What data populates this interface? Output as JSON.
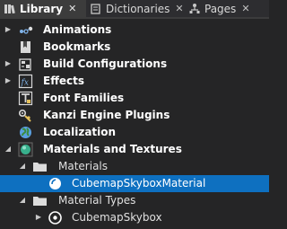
{
  "tabs": [
    {
      "label": "Library",
      "active": true,
      "icon": "library-icon"
    },
    {
      "label": "Dictionaries",
      "active": false,
      "icon": "book-icon"
    },
    {
      "label": "Pages",
      "active": false,
      "icon": "pages-icon"
    }
  ],
  "tab_close_glyph": "✕",
  "tree": {
    "items": [
      {
        "label": "Animations",
        "icon": "animation-icon",
        "expander": "collapsed"
      },
      {
        "label": "Bookmarks",
        "icon": "bookmark-icon",
        "expander": "none"
      },
      {
        "label": "Build Configurations",
        "icon": "build-icon",
        "expander": "collapsed"
      },
      {
        "label": "Effects",
        "icon": "fx-icon",
        "expander": "collapsed"
      },
      {
        "label": "Font Families",
        "icon": "font-icon",
        "expander": "none"
      },
      {
        "label": "Kanzi Engine Plugins",
        "icon": "plugin-icon",
        "expander": "none"
      },
      {
        "label": "Localization",
        "icon": "globe-icon",
        "expander": "none"
      },
      {
        "label": "Materials and Textures",
        "icon": "sphere-icon",
        "expander": "expanded"
      },
      {
        "label": "Materials",
        "icon": "folder-icon",
        "expander": "expanded"
      },
      {
        "label": "CubemapSkyboxMaterial",
        "icon": "material-icon",
        "expander": "none",
        "selected": true
      },
      {
        "label": "Material Types",
        "icon": "folder-icon",
        "expander": "expanded"
      },
      {
        "label": "CubemapSkybox",
        "icon": "material-type-icon",
        "expander": "collapsed"
      }
    ]
  },
  "colors": {
    "background": "#252526",
    "selection": "#0e70c0",
    "folder": "#dcdcdc"
  }
}
